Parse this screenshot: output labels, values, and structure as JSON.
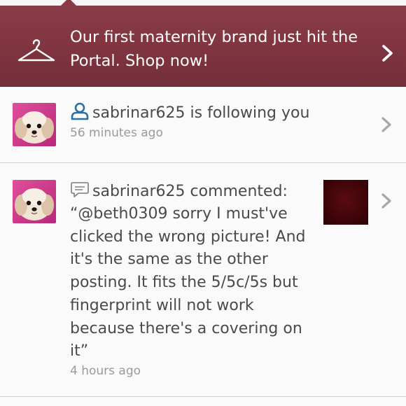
{
  "banner": {
    "text": "Our first maternity brand just hit the Portal. Shop now!",
    "icon": "hanger-icon",
    "color": "#7f3440"
  },
  "notifications": [
    {
      "username": "sabrinar625",
      "action": "is following you",
      "message": "sabrinar625 is following you",
      "time": "56 minutes ago",
      "icon": "follow-person-icon"
    },
    {
      "username": "sabrinar625",
      "action": "commented:",
      "message": "sabrinar625 commented:",
      "comment": "“@beth0309 sorry I must've clicked the wrong picture! And it's the same as the other posting. It fits the 5/5c/5s but fingerprint will not work because there's a covering on it”",
      "time": "4 hours ago",
      "icon": "comment-bubble-icon"
    }
  ],
  "colors": {
    "accent": "#2a6fa0",
    "text": "#4a4a4a",
    "muted": "#9a9a9a"
  }
}
